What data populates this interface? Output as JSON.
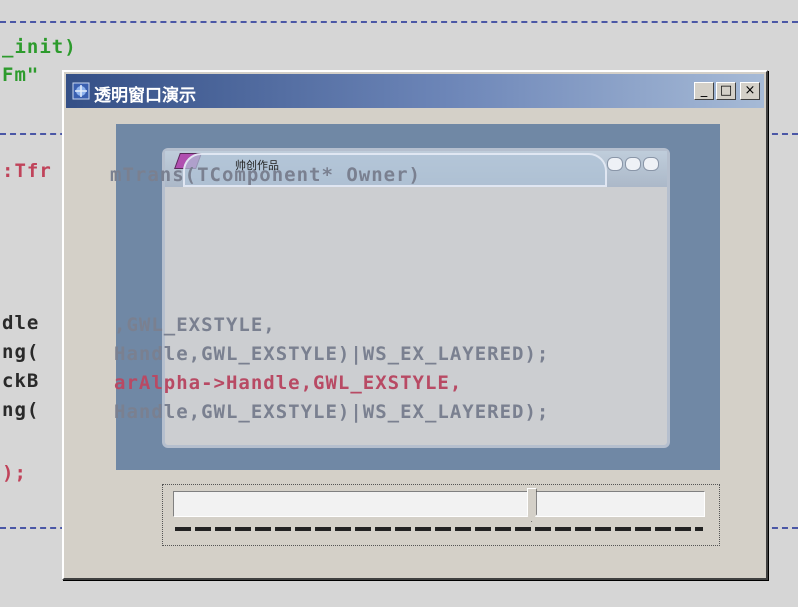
{
  "editor": {
    "lines": [
      {
        "text": "_init)",
        "color": "#2d9b2d"
      },
      {
        "text": "Fm\"",
        "color": "#2d9b2d"
      },
      {
        "text": ":Tfr",
        "color": "#c0435a"
      },
      {
        "text": "dle",
        "color": "#2a2a2a"
      },
      {
        "text": "ng(",
        "color": "#2a2a2a"
      },
      {
        "text": "ckB",
        "color": "#2a2a2a"
      },
      {
        "text": "ng(",
        "color": "#2a2a2a"
      },
      {
        "text": ");",
        "color": "#c0435a"
      }
    ],
    "overlay": [
      "mTrans(TComponent* Owner)",
      ",GWL_EXSTYLE,",
      "Handle,GWL_EXSTYLE)|WS_EX_LAYERED);",
      "arAlpha->Handle,GWL_EXSTYLE,",
      "Handle,GWL_EXSTYLE)|WS_EX_LAYERED);"
    ]
  },
  "window": {
    "title": "透明窗口演示",
    "icon": "window-app-icon",
    "buttons": {
      "minimize": "_",
      "maximize": "□",
      "close": "×"
    }
  },
  "skin_window": {
    "title": "帅创作品",
    "icon": "book-icon"
  },
  "trackbar": {
    "value": 0.68
  },
  "colors": {
    "titlebar_start": "#344f86",
    "titlebar_end": "#a6bad6",
    "overlay_area": "#4669a0"
  }
}
